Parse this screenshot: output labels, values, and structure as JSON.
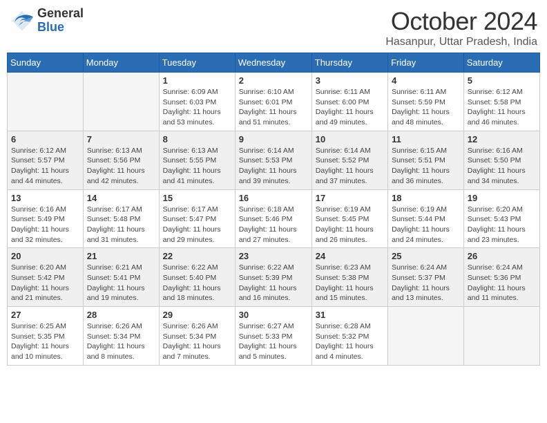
{
  "logo": {
    "general": "General",
    "blue": "Blue"
  },
  "title": "October 2024",
  "location": "Hasanpur, Uttar Pradesh, India",
  "weekdays": [
    "Sunday",
    "Monday",
    "Tuesday",
    "Wednesday",
    "Thursday",
    "Friday",
    "Saturday"
  ],
  "weeks": [
    [
      {
        "day": "",
        "info": ""
      },
      {
        "day": "",
        "info": ""
      },
      {
        "day": "1",
        "info": "Sunrise: 6:09 AM\nSunset: 6:03 PM\nDaylight: 11 hours and 53 minutes."
      },
      {
        "day": "2",
        "info": "Sunrise: 6:10 AM\nSunset: 6:01 PM\nDaylight: 11 hours and 51 minutes."
      },
      {
        "day": "3",
        "info": "Sunrise: 6:11 AM\nSunset: 6:00 PM\nDaylight: 11 hours and 49 minutes."
      },
      {
        "day": "4",
        "info": "Sunrise: 6:11 AM\nSunset: 5:59 PM\nDaylight: 11 hours and 48 minutes."
      },
      {
        "day": "5",
        "info": "Sunrise: 6:12 AM\nSunset: 5:58 PM\nDaylight: 11 hours and 46 minutes."
      }
    ],
    [
      {
        "day": "6",
        "info": "Sunrise: 6:12 AM\nSunset: 5:57 PM\nDaylight: 11 hours and 44 minutes."
      },
      {
        "day": "7",
        "info": "Sunrise: 6:13 AM\nSunset: 5:56 PM\nDaylight: 11 hours and 42 minutes."
      },
      {
        "day": "8",
        "info": "Sunrise: 6:13 AM\nSunset: 5:55 PM\nDaylight: 11 hours and 41 minutes."
      },
      {
        "day": "9",
        "info": "Sunrise: 6:14 AM\nSunset: 5:53 PM\nDaylight: 11 hours and 39 minutes."
      },
      {
        "day": "10",
        "info": "Sunrise: 6:14 AM\nSunset: 5:52 PM\nDaylight: 11 hours and 37 minutes."
      },
      {
        "day": "11",
        "info": "Sunrise: 6:15 AM\nSunset: 5:51 PM\nDaylight: 11 hours and 36 minutes."
      },
      {
        "day": "12",
        "info": "Sunrise: 6:16 AM\nSunset: 5:50 PM\nDaylight: 11 hours and 34 minutes."
      }
    ],
    [
      {
        "day": "13",
        "info": "Sunrise: 6:16 AM\nSunset: 5:49 PM\nDaylight: 11 hours and 32 minutes."
      },
      {
        "day": "14",
        "info": "Sunrise: 6:17 AM\nSunset: 5:48 PM\nDaylight: 11 hours and 31 minutes."
      },
      {
        "day": "15",
        "info": "Sunrise: 6:17 AM\nSunset: 5:47 PM\nDaylight: 11 hours and 29 minutes."
      },
      {
        "day": "16",
        "info": "Sunrise: 6:18 AM\nSunset: 5:46 PM\nDaylight: 11 hours and 27 minutes."
      },
      {
        "day": "17",
        "info": "Sunrise: 6:19 AM\nSunset: 5:45 PM\nDaylight: 11 hours and 26 minutes."
      },
      {
        "day": "18",
        "info": "Sunrise: 6:19 AM\nSunset: 5:44 PM\nDaylight: 11 hours and 24 minutes."
      },
      {
        "day": "19",
        "info": "Sunrise: 6:20 AM\nSunset: 5:43 PM\nDaylight: 11 hours and 23 minutes."
      }
    ],
    [
      {
        "day": "20",
        "info": "Sunrise: 6:20 AM\nSunset: 5:42 PM\nDaylight: 11 hours and 21 minutes."
      },
      {
        "day": "21",
        "info": "Sunrise: 6:21 AM\nSunset: 5:41 PM\nDaylight: 11 hours and 19 minutes."
      },
      {
        "day": "22",
        "info": "Sunrise: 6:22 AM\nSunset: 5:40 PM\nDaylight: 11 hours and 18 minutes."
      },
      {
        "day": "23",
        "info": "Sunrise: 6:22 AM\nSunset: 5:39 PM\nDaylight: 11 hours and 16 minutes."
      },
      {
        "day": "24",
        "info": "Sunrise: 6:23 AM\nSunset: 5:38 PM\nDaylight: 11 hours and 15 minutes."
      },
      {
        "day": "25",
        "info": "Sunrise: 6:24 AM\nSunset: 5:37 PM\nDaylight: 11 hours and 13 minutes."
      },
      {
        "day": "26",
        "info": "Sunrise: 6:24 AM\nSunset: 5:36 PM\nDaylight: 11 hours and 11 minutes."
      }
    ],
    [
      {
        "day": "27",
        "info": "Sunrise: 6:25 AM\nSunset: 5:35 PM\nDaylight: 11 hours and 10 minutes."
      },
      {
        "day": "28",
        "info": "Sunrise: 6:26 AM\nSunset: 5:34 PM\nDaylight: 11 hours and 8 minutes."
      },
      {
        "day": "29",
        "info": "Sunrise: 6:26 AM\nSunset: 5:34 PM\nDaylight: 11 hours and 7 minutes."
      },
      {
        "day": "30",
        "info": "Sunrise: 6:27 AM\nSunset: 5:33 PM\nDaylight: 11 hours and 5 minutes."
      },
      {
        "day": "31",
        "info": "Sunrise: 6:28 AM\nSunset: 5:32 PM\nDaylight: 11 hours and 4 minutes."
      },
      {
        "day": "",
        "info": ""
      },
      {
        "day": "",
        "info": ""
      }
    ]
  ]
}
